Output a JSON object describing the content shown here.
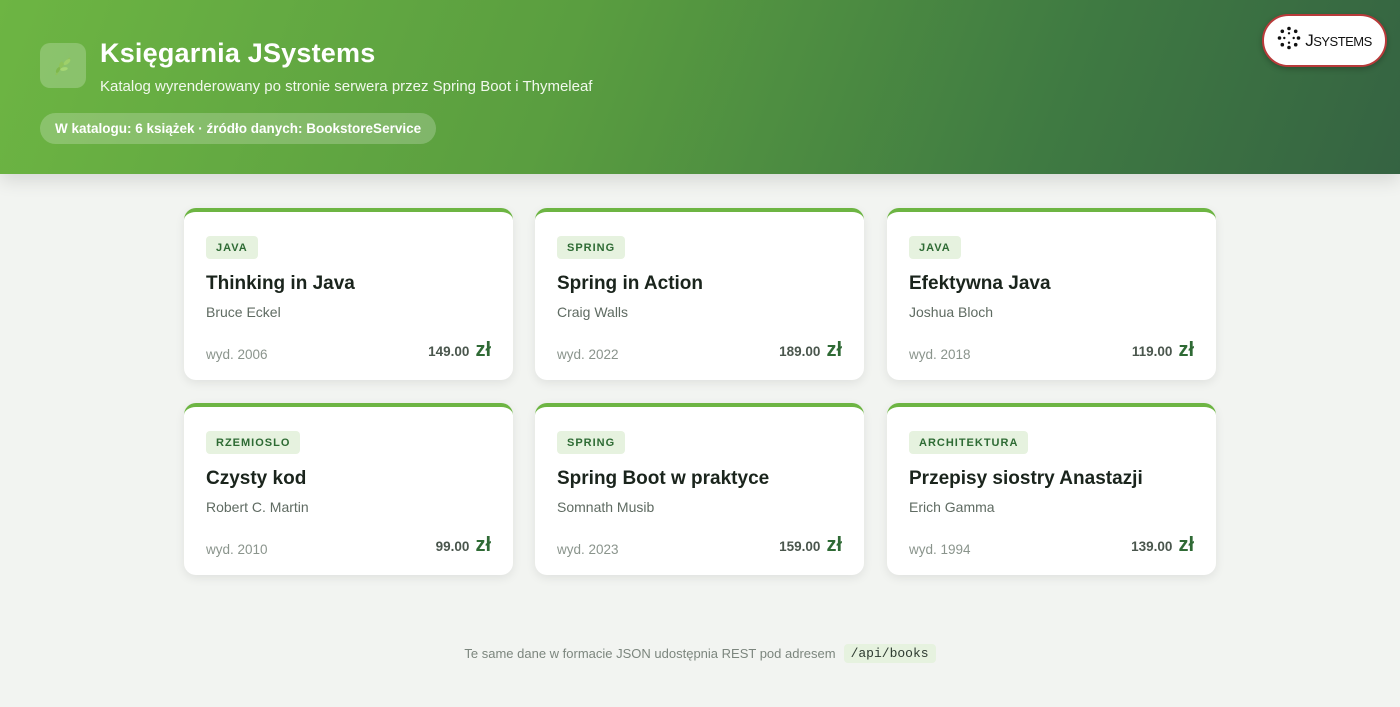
{
  "header": {
    "title": "Księgarnia JSystems",
    "subtitle": "Katalog wyrenderowany po stronie serwera przez Spring Boot i Thymeleaf",
    "catalog_info": "W katalogu: 6 książek · źródło danych: BookstoreService",
    "logo_icon": "leaf-icon",
    "brand": {
      "logo": "JSystems"
    }
  },
  "books": [
    {
      "category": "JAVA",
      "title": "Thinking in Java",
      "author": "Bruce Eckel",
      "year": "wyd. 2006",
      "price": "149.00",
      "currency": "zł"
    },
    {
      "category": "SPRING",
      "title": "Spring in Action",
      "author": "Craig Walls",
      "year": "wyd. 2022",
      "price": "189.00",
      "currency": "zł"
    },
    {
      "category": "JAVA",
      "title": "Efektywna Java",
      "author": "Joshua Bloch",
      "year": "wyd. 2018",
      "price": "119.00",
      "currency": "zł"
    },
    {
      "category": "RZEMIOSLO",
      "title": "Czysty kod",
      "author": "Robert C. Martin",
      "year": "wyd. 2010",
      "price": "99.00",
      "currency": "zł"
    },
    {
      "category": "SPRING",
      "title": "Spring Boot w praktyce",
      "author": "Somnath Musib",
      "year": "wyd. 2023",
      "price": "159.00",
      "currency": "zł"
    },
    {
      "category": "ARCHITEKTURA",
      "title": "Przepisy siostry Anastazji",
      "author": "Erich Gamma",
      "year": "wyd. 1994",
      "price": "139.00",
      "currency": "zł"
    }
  ],
  "footer": {
    "text": "Te same dane w formacie JSON udostępnia REST pod adresem",
    "api_path": "/api/books"
  },
  "colors": {
    "accent": "#6db543",
    "dark_green": "#356342",
    "tag_bg": "#e6f2df",
    "brand_border": "#b83a3a"
  }
}
